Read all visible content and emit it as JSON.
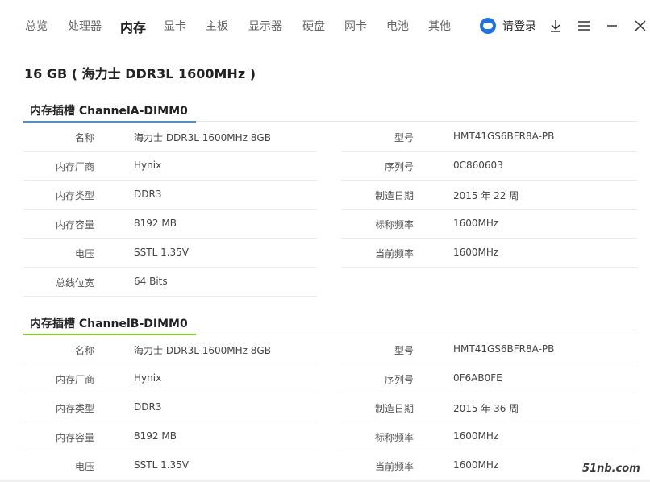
{
  "nav": {
    "tabs": [
      "总览",
      "处理器",
      "内存",
      "显卡",
      "主板",
      "显示器",
      "硬盘",
      "网卡",
      "电池",
      "其他"
    ],
    "active_tab": "内存",
    "login_label": "请登录"
  },
  "page_title": "16 GB ( 海力士 DDR3L 1600MHz )",
  "colors": {
    "accent_blue": "#4a90d9",
    "accent_green": "#7ed321",
    "icon_blue": "#1a73e8"
  },
  "sections": [
    {
      "title": "内存插槽 ChannelA-DIMM0",
      "accent": "blue",
      "left": [
        {
          "label": "名称",
          "value": "海力士 DDR3L 1600MHz 8GB"
        },
        {
          "label": "内存厂商",
          "value": "Hynix"
        },
        {
          "label": "内存类型",
          "value": "DDR3"
        },
        {
          "label": "内存容量",
          "value": "8192 MB"
        },
        {
          "label": "电压",
          "value": "SSTL 1.35V"
        },
        {
          "label": "总线位宽",
          "value": "64 Bits"
        }
      ],
      "right": [
        {
          "label": "型号",
          "value": "HMT41GS6BFR8A-PB"
        },
        {
          "label": "序列号",
          "value": "0C860603"
        },
        {
          "label": "制造日期",
          "value": "2015 年 22 周"
        },
        {
          "label": "标称频率",
          "value": "1600MHz"
        },
        {
          "label": "当前频率",
          "value": "1600MHz"
        }
      ]
    },
    {
      "title": "内存插槽 ChannelB-DIMM0",
      "accent": "green",
      "left": [
        {
          "label": "名称",
          "value": "海力士 DDR3L 1600MHz 8GB"
        },
        {
          "label": "内存厂商",
          "value": "Hynix"
        },
        {
          "label": "内存类型",
          "value": "DDR3"
        },
        {
          "label": "内存容量",
          "value": "8192 MB"
        },
        {
          "label": "电压",
          "value": "SSTL 1.35V"
        }
      ],
      "right": [
        {
          "label": "型号",
          "value": "HMT41GS6BFR8A-PB"
        },
        {
          "label": "序列号",
          "value": "0F6AB0FE"
        },
        {
          "label": "制造日期",
          "value": "2015 年 36 周"
        },
        {
          "label": "标称频率",
          "value": "1600MHz"
        },
        {
          "label": "当前频率",
          "value": "1600MHz"
        }
      ]
    }
  ],
  "watermark": "51nb.com"
}
